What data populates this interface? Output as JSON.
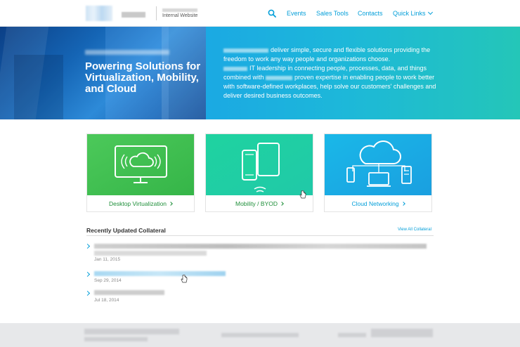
{
  "header": {
    "site_label": "Internal Website",
    "nav": {
      "events": "Events",
      "sales_tools": "Sales Tools",
      "contacts": "Contacts",
      "quick_links": "Quick Links"
    },
    "icons": {
      "search": "search-icon",
      "quick_links_chevron": "chevron-down-icon"
    },
    "accent_color": "#049fd9"
  },
  "hero": {
    "title": "Powering Solutions for Virtualization, Mobility, and Cloud",
    "body_segments": {
      "s1": "deliver simple, secure and flexible solutions providing the freedom to work any way people and organizations choose.",
      "s2": "IT leadership in connecting people, processes, data, and things combined with",
      "s3": "proven expertise in enabling people to work better with software-defined workplaces, help solve our customers' challenges and deliver desired business outcomes."
    }
  },
  "cards": [
    {
      "label": "Desktop Virtualization",
      "icon": "cloud-monitor-icon",
      "color": "#3dbf4f"
    },
    {
      "label": "Mobility / BYOD",
      "icon": "mobile-tablet-icon",
      "color": "#22d3a4"
    },
    {
      "label": "Cloud Networking",
      "icon": "cloud-network-icon",
      "color": "#1aa8e5"
    }
  ],
  "collateral": {
    "title": "Recently Updated Collateral",
    "view_all": "View All Collateral",
    "items": [
      {
        "date": "Jan 11, 2015"
      },
      {
        "date": "Sep 29, 2014"
      },
      {
        "date": "Jul 18, 2014"
      }
    ]
  }
}
